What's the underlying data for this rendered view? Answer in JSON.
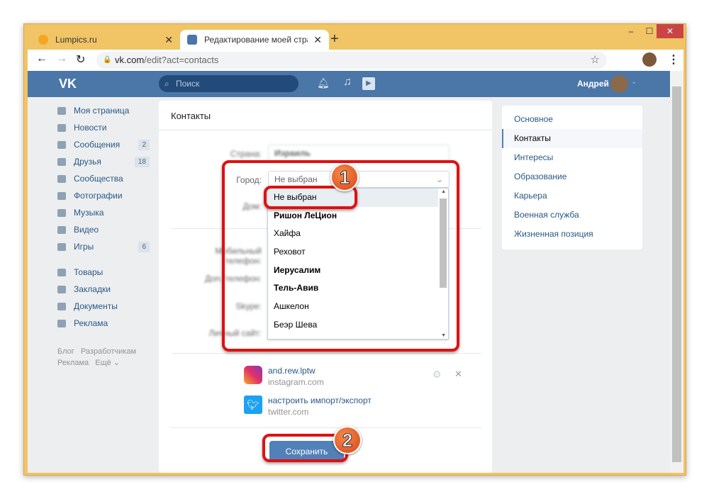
{
  "browser": {
    "tabs": [
      {
        "title": "Lumpics.ru"
      },
      {
        "title": "Редактирование моей страницы"
      }
    ],
    "new_tab": "+",
    "close": "✕",
    "url_host": "vk.com",
    "url_path": "/edit?act=contacts",
    "minimize": "–",
    "maximize": "☐",
    "close_window": "✕"
  },
  "header": {
    "logo": "VK",
    "search_placeholder": "Поиск",
    "user_name": "Андрей"
  },
  "sidebar": {
    "items": [
      {
        "label": "Моя страница"
      },
      {
        "label": "Новости"
      },
      {
        "label": "Сообщения",
        "badge": "2"
      },
      {
        "label": "Друзья",
        "badge": "18"
      },
      {
        "label": "Сообщества"
      },
      {
        "label": "Фотографии"
      },
      {
        "label": "Музыка"
      },
      {
        "label": "Видео"
      },
      {
        "label": "Игры",
        "badge": "6"
      },
      {
        "label": "Товары"
      },
      {
        "label": "Закладки"
      },
      {
        "label": "Документы"
      },
      {
        "label": "Реклама"
      }
    ],
    "footer": [
      "Блог",
      "Разработчикам",
      "Реклама",
      "Ещё ⌄"
    ]
  },
  "main": {
    "title": "Контакты",
    "country_label": "Страна:",
    "country_value": "Израиль",
    "city_label": "Город:",
    "city_value": "Не выбран",
    "home_label": "Дом:",
    "mobile_label": "Мобильный телефон:",
    "extra_phone_label": "Доп. телефон:",
    "skype_label": "Skype:",
    "site_label": "Личный сайт:",
    "city_options": [
      {
        "label": "Не выбран",
        "bold": false
      },
      {
        "label": "Ришон ЛеЦион",
        "bold": true
      },
      {
        "label": "Хайфа",
        "bold": false
      },
      {
        "label": "Реховот",
        "bold": false
      },
      {
        "label": "Иерусалим",
        "bold": true
      },
      {
        "label": "Тель-Авив",
        "bold": true
      },
      {
        "label": "Ашкелон",
        "bold": false
      },
      {
        "label": "Беэр Шева",
        "bold": false
      }
    ],
    "instagram": {
      "name": "and.rew.lptw",
      "site": "instagram.com"
    },
    "twitter": {
      "name": "настроить импорт/экспорт",
      "site": "twitter.com"
    },
    "save": "Сохранить"
  },
  "right_menu": [
    "Основное",
    "Контакты",
    "Интересы",
    "Образование",
    "Карьера",
    "Военная служба",
    "Жизненная позиция"
  ],
  "annotations": [
    "1",
    "2"
  ],
  "colors": {
    "vk_blue": "#4a76a8",
    "highlight": "#e01010",
    "frame": "#f1c465"
  }
}
